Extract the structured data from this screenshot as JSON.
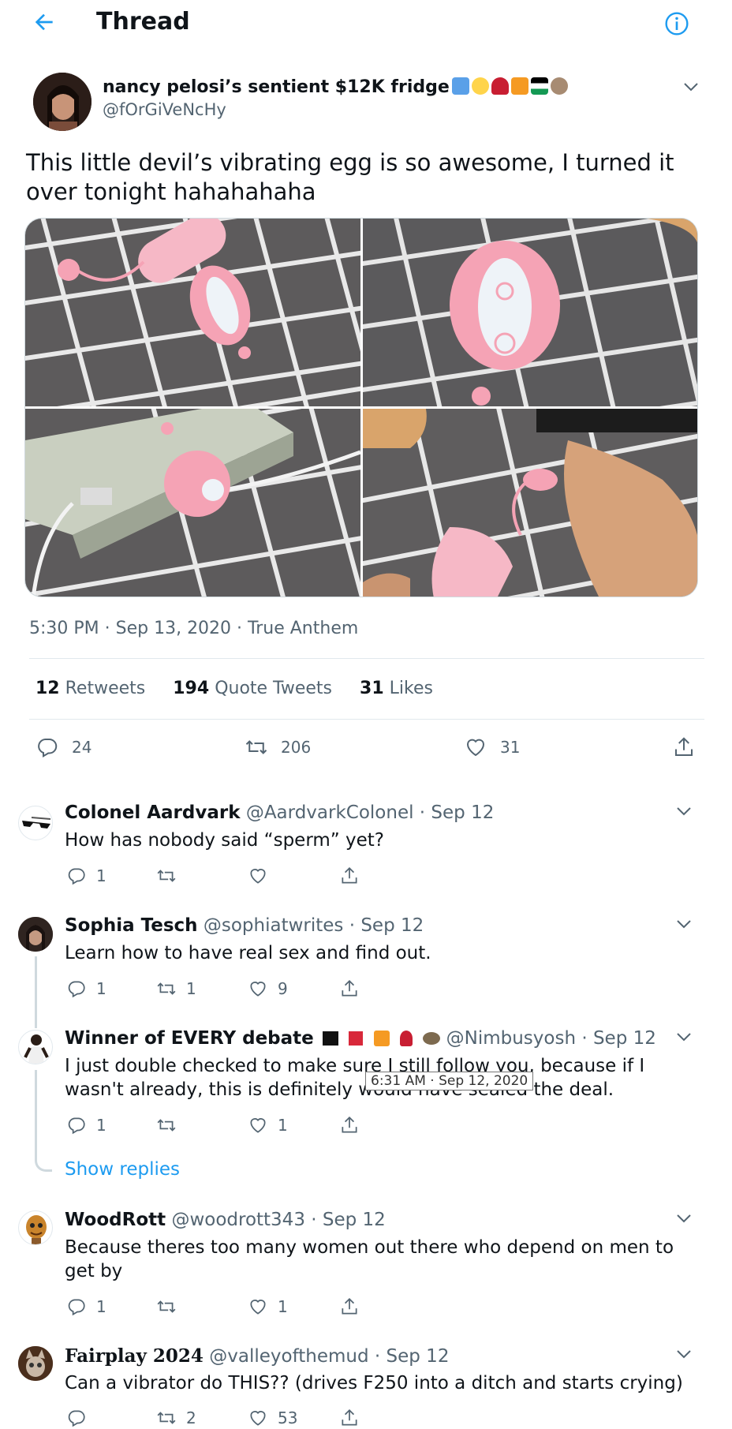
{
  "header": {
    "title": "Thread"
  },
  "main_tweet": {
    "name": "nancy pelosi’s sentient $12K fridge",
    "handle": "@fOrGiVeNcHy",
    "text": "This little devil’s vibrating egg is so awesome, I turned it over tonight hahahahaha",
    "meta": "5:30 PM · Sep 13, 2020 · True Anthem",
    "stats": {
      "retweets_count": "12",
      "retweets_label": "Retweets",
      "quotes_count": "194",
      "quotes_label": "Quote Tweets",
      "likes_count": "31",
      "likes_label": "Likes"
    },
    "actions": {
      "replies": "24",
      "retweets": "206",
      "likes": "31"
    }
  },
  "replies": [
    {
      "name": "Colonel Aardvark",
      "handle": "@AardvarkColonel · Sep 12",
      "text": "How has nobody said “sperm” yet?",
      "replies": "1",
      "retweets": "",
      "likes": ""
    },
    {
      "name": "Sophia Tesch",
      "handle": "@sophiatwrites · Sep 12",
      "text": "Learn how to have real sex and find out.",
      "replies": "1",
      "retweets": "1",
      "likes": "9"
    },
    {
      "name": "Winner of EVERY debate",
      "handle": "@Nimbusyosh · Sep 12",
      "text": "I just double checked to make sure I still follow you, because if I wasn't already, this is definitely would have sealed the deal.",
      "replies": "1",
      "retweets": "",
      "likes": "1"
    },
    {
      "name": "WoodRott",
      "handle": "@woodrott343 · Sep 12",
      "text": "Because theres too many women out there who depend on men to get by",
      "replies": "1",
      "retweets": "",
      "likes": "1"
    },
    {
      "name": "Fairplay 2024",
      "handle": "@valleyofthemud · Sep 12",
      "text": "Can a vibrator do THIS?? (drives F250 into a ditch and starts crying)",
      "replies": "",
      "retweets": "2",
      "likes": "53"
    }
  ],
  "show_replies": "Show replies",
  "tooltip": "6:31 AM · Sep 12, 2020",
  "colors": {
    "accent": "#1d9bf0",
    "muted": "#536471",
    "text": "#0f1419",
    "divider": "#e1e8ed"
  },
  "icons": [
    "back-arrow-icon",
    "info-icon",
    "chevron-down-icon",
    "reply-icon",
    "retweet-icon",
    "like-icon",
    "share-icon"
  ]
}
